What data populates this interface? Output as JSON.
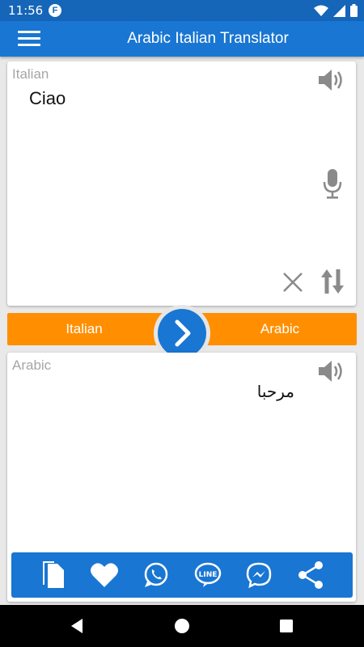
{
  "status": {
    "time": "11:56",
    "app_notification": "F"
  },
  "appbar": {
    "title": "Arabic Italian Translator"
  },
  "source": {
    "language": "Italian",
    "text": "Ciao"
  },
  "langbar": {
    "source": "Italian",
    "target": "Arabic"
  },
  "target": {
    "language": "Arabic",
    "text": "مرحبا"
  },
  "actions": [
    "copy-icon",
    "favorite-icon",
    "whatsapp-icon",
    "line-icon",
    "messenger-icon",
    "share-icon"
  ],
  "colors": {
    "primary": "#1976d2",
    "status": "#1565b8",
    "accent": "#ff8f00",
    "icon_gray": "#8a8a8a"
  }
}
